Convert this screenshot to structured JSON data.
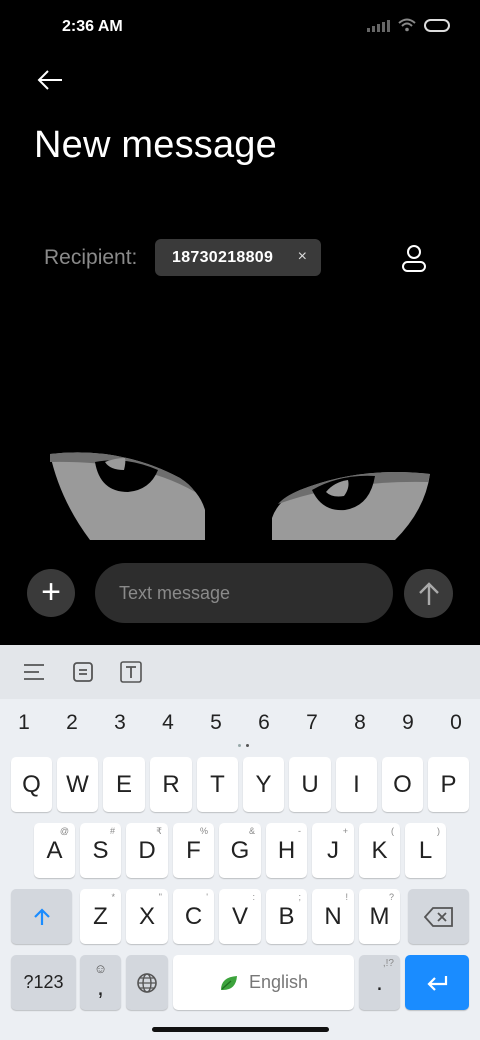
{
  "status_bar": {
    "time": "2:36 AM"
  },
  "header": {
    "title": "New message"
  },
  "recipient": {
    "label": "Recipient:",
    "chip_number": "18730218809",
    "chip_remove": "×"
  },
  "composer": {
    "placeholder": "Text message"
  },
  "keyboard": {
    "numbers": [
      "1",
      "2",
      "3",
      "4",
      "5",
      "6",
      "7",
      "8",
      "9",
      "0"
    ],
    "row1": [
      "Q",
      "W",
      "E",
      "R",
      "T",
      "Y",
      "U",
      "I",
      "O",
      "P"
    ],
    "row2": [
      "A",
      "S",
      "D",
      "F",
      "G",
      "H",
      "J",
      "K",
      "L"
    ],
    "row2_hints": [
      "@",
      "#",
      "₹",
      "%",
      "&",
      "-",
      "+",
      "(",
      ")"
    ],
    "row3": [
      "Z",
      "X",
      "C",
      "V",
      "B",
      "N",
      "M"
    ],
    "row3_hints": [
      "*",
      "\"",
      "'",
      ":",
      ";",
      "!",
      "?"
    ],
    "symbols_label": "?123",
    "comma": ",",
    "space_label": "English",
    "period": ".",
    "period_hint": ",!?"
  },
  "colors": {
    "accent": "#1a8cff",
    "background": "#000000",
    "keyboard_bg": "#eceff3"
  }
}
